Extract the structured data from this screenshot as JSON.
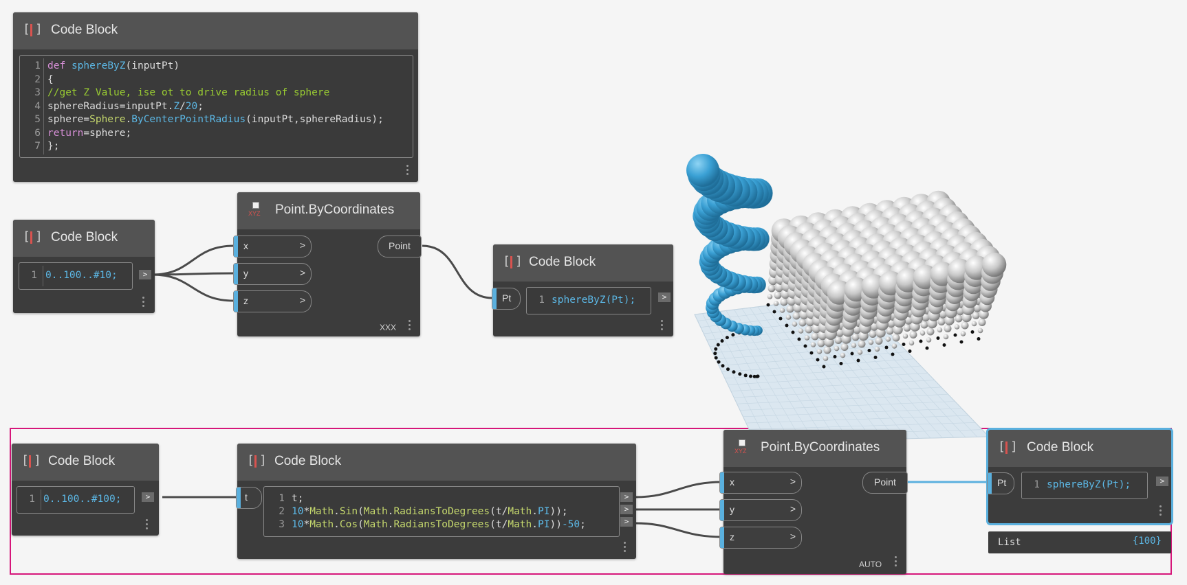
{
  "colors": {
    "wire": "#4a4a4a",
    "wire_selected": "#5ab0de",
    "selection": "#d6167a",
    "port_accent": "#5ab0de",
    "node_body": "#3c3c3c",
    "node_header": "#535353"
  },
  "top_code_block": {
    "title": "Code Block",
    "lines": [
      "1",
      "2",
      "3",
      "4",
      "5",
      "6",
      "7"
    ]
  },
  "mid_range_block": {
    "title": "Code Block",
    "line_no": "1",
    "code": "0..100..#10;",
    "out": ">"
  },
  "mid_point": {
    "title": "Point.ByCoordinates",
    "icon_text": "XYZ",
    "inputs": [
      "x",
      "y",
      "z"
    ],
    "chevron": ">",
    "output": "Point",
    "lacing": "XXX"
  },
  "mid_sphere_block": {
    "title": "Code Block",
    "input": "Pt",
    "line_no": "1",
    "code": "sphereByZ(Pt);",
    "out": ">"
  },
  "bottom_range_block": {
    "title": "Code Block",
    "line_no": "1",
    "code": "0..100..#100;",
    "out": ">"
  },
  "bottom_trig_block": {
    "title": "Code Block",
    "input": "t",
    "line_nos": [
      "1",
      "2",
      "3"
    ],
    "outs": [
      ">",
      ">",
      ">"
    ]
  },
  "bottom_point": {
    "title": "Point.ByCoordinates",
    "icon_text": "XYZ",
    "inputs": [
      "x",
      "y",
      "z"
    ],
    "chevron": ">",
    "output": "Point",
    "lacing": "AUTO"
  },
  "bottom_sphere_block": {
    "title": "Code Block",
    "input": "Pt",
    "line_no": "1",
    "code": "sphereByZ(Pt);",
    "out": ">"
  },
  "preview": {
    "label": "List",
    "count": "{100}"
  }
}
